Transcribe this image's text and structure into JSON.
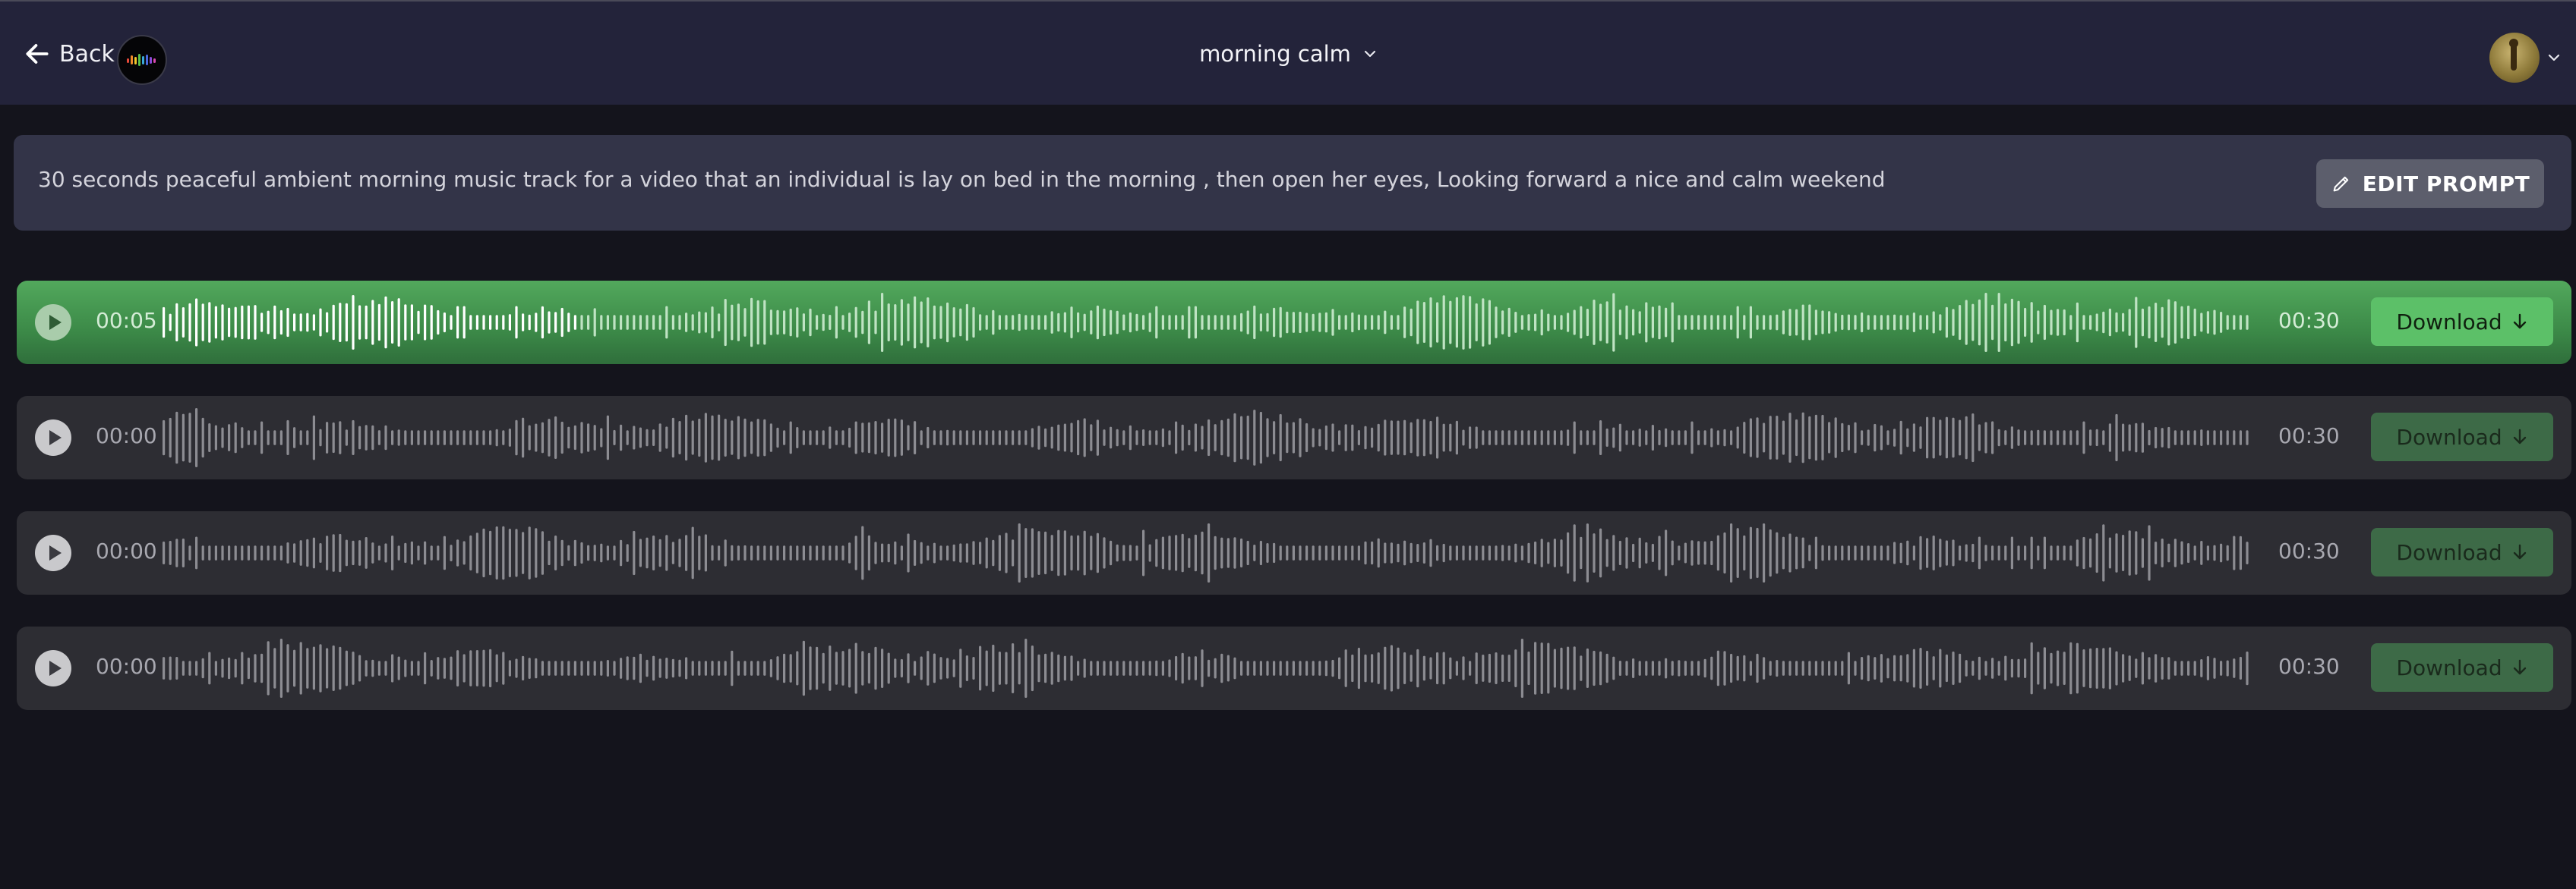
{
  "header": {
    "back_label": "Back",
    "title": "morning calm",
    "logo_icon": "equalizer-logo-icon",
    "avatar_icon": "user-avatar-icon"
  },
  "prompt": {
    "text": "30 seconds peaceful ambient morning music track for a video that an individual is lay on bed in the morning , then open her eyes, Looking forward a nice and calm weekend",
    "edit_label": "EDIT PROMPT"
  },
  "tracks": [
    {
      "start_time": "00:05",
      "end_time": "00:30",
      "download_label": "Download",
      "active": true,
      "progress": 0.2
    },
    {
      "start_time": "00:00",
      "end_time": "00:30",
      "download_label": "Download",
      "active": false,
      "progress": 0
    },
    {
      "start_time": "00:00",
      "end_time": "00:30",
      "download_label": "Download",
      "active": false,
      "progress": 0
    },
    {
      "start_time": "00:00",
      "end_time": "00:30",
      "download_label": "Download",
      "active": false,
      "progress": 0
    }
  ],
  "colors": {
    "background": "#14141c",
    "header": "#23233a",
    "active_track": "#4caa5a",
    "download_active": "#5cc068",
    "download_inactive": "#3d6a47"
  }
}
